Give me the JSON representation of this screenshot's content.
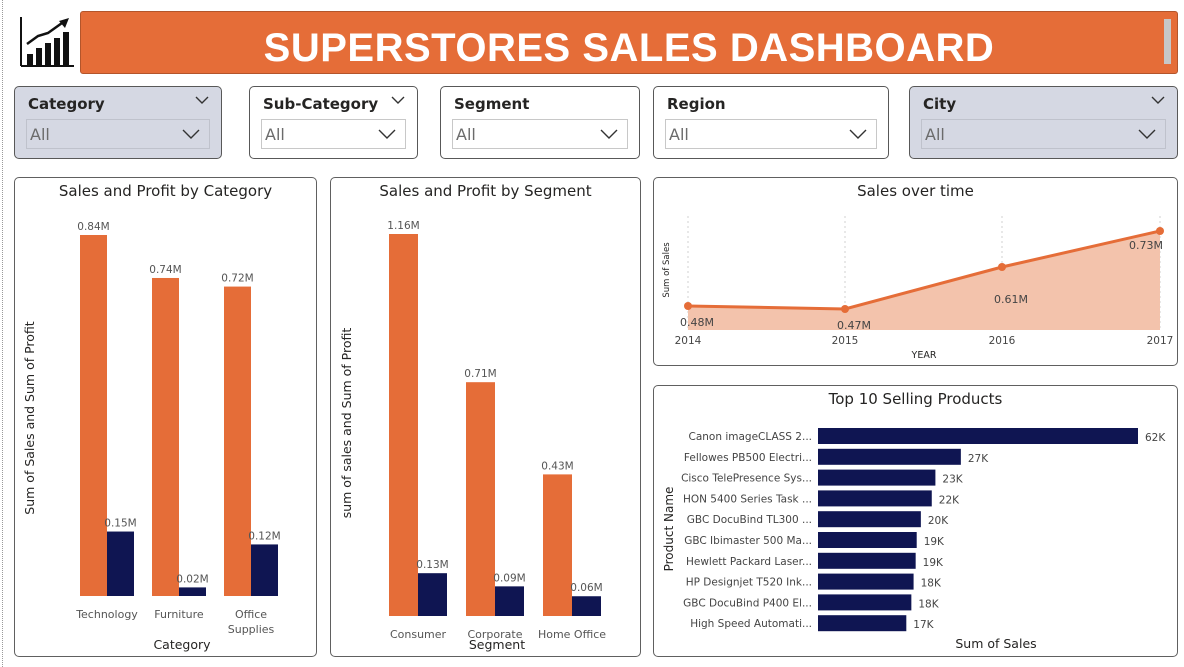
{
  "header": {
    "title": "SUPERSTORES SALES DASHBOARD"
  },
  "colors": {
    "sales": "#e56d38",
    "profit": "#0f1552",
    "accent": "#e56d38",
    "area_fill": "#f3c3ac"
  },
  "icons": {
    "logo": "bar-chart-growth-icon",
    "dropdown": "chevron-down-icon"
  },
  "filters": [
    {
      "label": "Category",
      "value": "All"
    },
    {
      "label": "Sub-Category",
      "value": "All"
    },
    {
      "label": "Segment",
      "value": "All"
    },
    {
      "label": "Region",
      "value": "All"
    },
    {
      "label": "City",
      "value": "All"
    }
  ],
  "chart_data": [
    {
      "type": "bar",
      "title": "Sales and Profit by Category",
      "xlabel": "Category",
      "ylabel": "Sum of Sales and Sum of Profit",
      "categories": [
        "Technology",
        "Furniture",
        "Office Supplies"
      ],
      "category_label_lines": [
        [
          "Technology"
        ],
        [
          "Furniture"
        ],
        [
          "Office",
          "Supplies"
        ]
      ],
      "series": [
        {
          "values": [
            0.84,
            0.74,
            0.72
          ],
          "labels": [
            "0.84M",
            "0.74M",
            "0.72M"
          ]
        },
        {
          "values": [
            0.15,
            0.02,
            0.12
          ],
          "labels": [
            "0.15M",
            "0.02M",
            "0.12M"
          ]
        }
      ],
      "ylim": [
        0,
        0.84
      ],
      "grid": false
    },
    {
      "type": "bar",
      "title": "Sales and Profit by Segment",
      "xlabel": "Segment",
      "ylabel": "sum of sales and Sum of Profit",
      "categories": [
        "Consumer",
        "Corporate",
        "Home Office"
      ],
      "category_label_lines": [
        [
          "Consumer"
        ],
        [
          "Corporate"
        ],
        [
          "Home Office"
        ]
      ],
      "series": [
        {
          "values": [
            1.16,
            0.71,
            0.43
          ],
          "labels": [
            "1.16M",
            "0.71M",
            "0.43M"
          ]
        },
        {
          "values": [
            0.13,
            0.09,
            0.06
          ],
          "labels": [
            "0.13M",
            "0.09M",
            "0.06M"
          ]
        }
      ],
      "ylim": [
        0,
        1.16
      ],
      "grid": false
    },
    {
      "type": "area",
      "title": "Sales over time",
      "xlabel": "YEAR",
      "ylabel": "Sum of Sales",
      "x": [
        "2014",
        "2015",
        "2016",
        "2017"
      ],
      "values": [
        0.48,
        0.47,
        0.61,
        0.73
      ],
      "labels": [
        "0.48M",
        "0.47M",
        "0.61M",
        "0.73M"
      ],
      "ylim": [
        0.4,
        0.74
      ],
      "grid": false
    },
    {
      "type": "bar",
      "orientation": "horizontal",
      "title": "Top 10 Selling Products",
      "xlabel": "Sum of Sales",
      "ylabel": "Product Name",
      "categories": [
        "Canon imageCLASS 2...",
        "Fellowes PB500 Electri...",
        "Cisco TelePresence Sys...",
        "HON 5400 Series Task ...",
        "GBC DocuBind TL300 ...",
        "GBC Ibimaster 500 Ma...",
        "Hewlett Packard Laser...",
        "HP Designjet T520 Ink...",
        "GBC DocuBind P400 El...",
        "High Speed Automati..."
      ],
      "values": [
        61.6,
        27.5,
        22.6,
        21.9,
        19.8,
        19.0,
        18.8,
        18.4,
        17.97,
        17.0
      ],
      "labels": [
        "62K",
        "27K",
        "23K",
        "22K",
        "20K",
        "19K",
        "19K",
        "18K",
        "18K",
        "17K"
      ],
      "xlim": [
        0,
        61.6
      ],
      "grid": false
    }
  ]
}
